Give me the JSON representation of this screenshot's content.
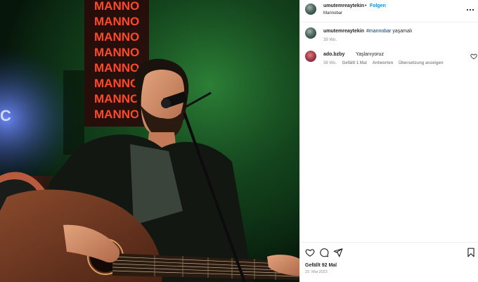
{
  "post": {
    "username": "umutemreaytekin",
    "separator": "•",
    "follow_label": "Folgen",
    "location": "Mannobar",
    "more_icon": "more-options-icon"
  },
  "caption": {
    "username": "umutemreaytekin",
    "hashtag": "#mannobar",
    "text": " yaşamalı",
    "time": "39 Wo."
  },
  "comment": {
    "username": "ado.bzby",
    "text": "Yaşlanıyoruz",
    "time": "38 Wo.",
    "likes": "Gefällt 1 Mal",
    "reply_label": "Antworten",
    "translate_label": "Übersetzung anzeigen"
  },
  "footer": {
    "likes": "Gefällt 92 Mal",
    "date": "22. Mai 2023"
  },
  "photo": {
    "sign_text": "MANNO",
    "neon_fragment": "C",
    "colors": {
      "neon_red": "#ff2a1c",
      "stage_green": "#1c5a2a",
      "blue_light": "#3a5bff"
    }
  },
  "colors": {
    "link_blue": "#0095f6",
    "muted": "#8e8e8e"
  }
}
